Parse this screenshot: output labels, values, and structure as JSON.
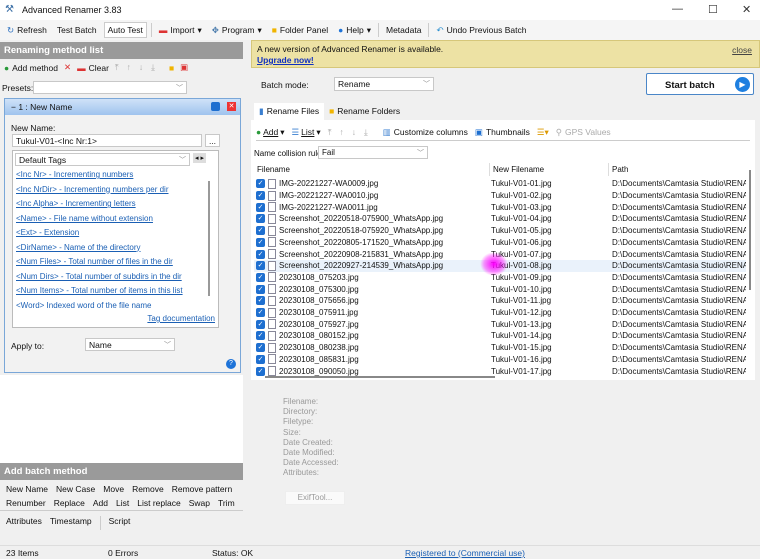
{
  "window": {
    "title": "Advanced Renamer 3.83"
  },
  "toolbar": [
    "Refresh",
    "Test Batch",
    "Auto Test",
    "Import",
    "Program",
    "Folder Panel",
    "Help",
    "Metadata",
    "Undo Previous Batch"
  ],
  "left": {
    "header": "Renaming method list",
    "add_method": "Add method",
    "clear": "Clear",
    "presets_label": "Presets:",
    "presets_value": "",
    "method_title": "1 : New Name",
    "new_name_label": "New Name:",
    "new_name_value": "Tukul-V01-<Inc Nr:1>",
    "browse": "...",
    "tags_select": "Default Tags",
    "tags": [
      "<Inc Nr> - Incrementing numbers",
      "<Inc NrDir> - Incrementing numbers per dir",
      "<Inc Alpha> - Incrementing letters",
      "<Name> - File name without extension",
      "<Ext> - Extension",
      "<DirName> - Name of the directory",
      "<Num Files> - Total number of files in the dir",
      "<Num Dirs> - Total number of subdirs in the dir",
      "<Num Items> - Total number of items in this list",
      "<Word> Indexed word of the file name"
    ],
    "tag_doc": "Tag documentation",
    "apply_label": "Apply to:",
    "apply_value": "Name",
    "batch_header": "Add batch method",
    "batch_rows": [
      [
        "New Name",
        "New Case",
        "Move",
        "Remove",
        "Remove pattern"
      ],
      [
        "Renumber",
        "Replace",
        "Add",
        "List",
        "List replace",
        "Swap",
        "Trim"
      ],
      [
        "Attributes",
        "Timestamp",
        "Script"
      ]
    ]
  },
  "notice": {
    "text": "A new version of Advanced Renamer is available.",
    "link": "Upgrade now!",
    "close": "close"
  },
  "batch_mode": {
    "label": "Batch mode:",
    "value": "Rename"
  },
  "start_batch": "Start batch",
  "tabs": [
    "Rename Files",
    "Rename Folders"
  ],
  "files_toolbar": {
    "add": "Add",
    "list": "List",
    "customize": "Customize columns",
    "thumbnails": "Thumbnails",
    "gps": "GPS Values"
  },
  "collision": {
    "label": "Name collision rule:",
    "value": "Fail"
  },
  "columns": [
    "Filename",
    "New Filename",
    "Path"
  ],
  "files": [
    [
      "IMG-20221227-WA0009.jpg",
      "Tukul-V01-01.jpg"
    ],
    [
      "IMG-20221227-WA0010.jpg",
      "Tukul-V01-02.jpg"
    ],
    [
      "IMG-20221227-WA0011.jpg",
      "Tukul-V01-03.jpg"
    ],
    [
      "Screenshot_20220518-075900_WhatsApp.jpg",
      "Tukul-V01-04.jpg"
    ],
    [
      "Screenshot_20220518-075920_WhatsApp.jpg",
      "Tukul-V01-05.jpg"
    ],
    [
      "Screenshot_20220805-171520_WhatsApp.jpg",
      "Tukul-V01-06.jpg"
    ],
    [
      "Screenshot_20220908-215831_WhatsApp.jpg",
      "Tukul-V01-07.jpg"
    ],
    [
      "Screenshot_20220927-214539_WhatsApp.jpg",
      "Tukul-V01-08.jpg"
    ],
    [
      "20230108_075203.jpg",
      "Tukul-V01-09.jpg"
    ],
    [
      "20230108_075300.jpg",
      "Tukul-V01-10.jpg"
    ],
    [
      "20230108_075656.jpg",
      "Tukul-V01-11.jpg"
    ],
    [
      "20230108_075911.jpg",
      "Tukul-V01-12.jpg"
    ],
    [
      "20230108_075927.jpg",
      "Tukul-V01-13.jpg"
    ],
    [
      "20230108_080152.jpg",
      "Tukul-V01-14.jpg"
    ],
    [
      "20230108_080238.jpg",
      "Tukul-V01-15.jpg"
    ],
    [
      "20230108_085831.jpg",
      "Tukul-V01-16.jpg"
    ],
    [
      "20230108_090050.jpg",
      "Tukul-V01-17.jpg"
    ]
  ],
  "path": "D:\\Documents\\Camtasia Studio\\RENAME",
  "info_labels": [
    "Filename:",
    "Directory:",
    "Filetype:",
    "Size:",
    "Date Created:",
    "Date Modified:",
    "Date Accessed:",
    "Attributes:"
  ],
  "exiftool": "ExifTool...",
  "status": {
    "items": "23 Items",
    "errors": "0 Errors",
    "status": "Status: OK",
    "registered": "Registered to  (Commercial use)"
  }
}
